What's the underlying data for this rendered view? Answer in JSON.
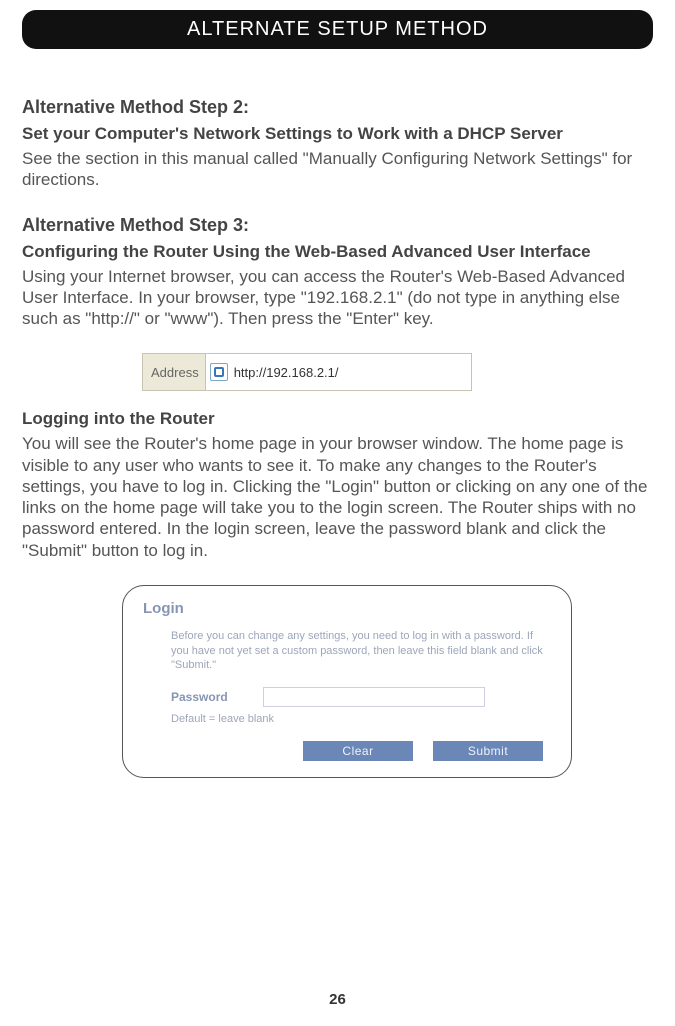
{
  "header": {
    "title": "ALTERNATE SETUP METHOD"
  },
  "step2": {
    "heading": "Alternative Method Step 2:",
    "subheading": "Set your Computer's Network Settings to Work with a DHCP Server",
    "body": "See the section in this manual called \"Manually Configuring Network Settings\" for directions."
  },
  "step3": {
    "heading": "Alternative Method Step 3:",
    "subheading": "Configuring the Router Using the Web-Based Advanced User Interface",
    "body": "Using your Internet browser, you can access the Router's Web-Based Advanced User Interface. In your browser, type \"192.168.2.1\" (do not type in anything else such as \"http://\" or \"www\"). Then press the \"Enter\" key."
  },
  "addressBar": {
    "label": "Address",
    "url": "http://192.168.2.1/"
  },
  "logging": {
    "heading": "Logging into the Router",
    "body": "You will see the Router's home page in your browser window. The home page is visible to any user who wants to see it. To make any changes to the Router's settings, you have to log in. Clicking the \"Login\" button or clicking on any one of the links on the home page will take you to the login screen. The Router ships with no password entered. In the login screen, leave the password blank and click the \"Submit\" button to log in."
  },
  "loginBox": {
    "title": "Login",
    "instructions": "Before you can change any settings, you need to log in with a password. If you have not yet set a custom password, then leave this field blank and click \"Submit.\"",
    "passwordLabel": "Password",
    "defaultText": "Default = leave blank",
    "clearButton": "Clear",
    "submitButton": "Submit"
  },
  "pageNumber": "26"
}
